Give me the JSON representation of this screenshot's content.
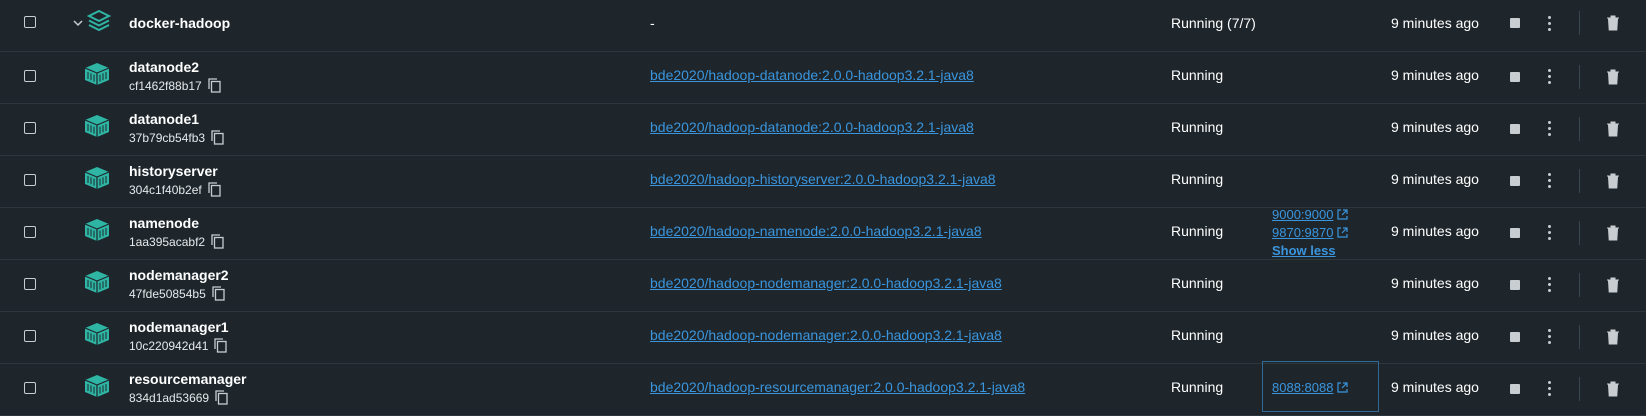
{
  "colors": {
    "background": "#1e262c",
    "accent": "#3a95dd",
    "icon_teal": "#2fb5a4"
  },
  "group": {
    "name": "docker-hadoop",
    "image": "-",
    "status": "Running (7/7)",
    "last_started": "9 minutes ago",
    "icon": "stack-icon"
  },
  "containers": [
    {
      "name": "datanode2",
      "id": "cf1462f88b17",
      "image": "bde2020/hadoop-datanode:2.0.0-hadoop3.2.1-java8",
      "status": "Running",
      "ports": [],
      "last_started": "9 minutes ago"
    },
    {
      "name": "datanode1",
      "id": "37b79cb54fb3",
      "image": "bde2020/hadoop-datanode:2.0.0-hadoop3.2.1-java8",
      "status": "Running",
      "ports": [],
      "last_started": "9 minutes ago"
    },
    {
      "name": "historyserver",
      "id": "304c1f40b2ef",
      "image": "bde2020/hadoop-historyserver:2.0.0-hadoop3.2.1-java8",
      "status": "Running",
      "ports": [],
      "last_started": "9 minutes ago"
    },
    {
      "name": "namenode",
      "id": "1aa395acabf2",
      "image": "bde2020/hadoop-namenode:2.0.0-hadoop3.2.1-java8",
      "status": "Running",
      "ports": [
        "9000:9000",
        "9870:9870"
      ],
      "ports_toggle": "Show less",
      "last_started": "9 minutes ago"
    },
    {
      "name": "nodemanager2",
      "id": "47fde50854b5",
      "image": "bde2020/hadoop-nodemanager:2.0.0-hadoop3.2.1-java8",
      "status": "Running",
      "ports": [],
      "last_started": "9 minutes ago"
    },
    {
      "name": "nodemanager1",
      "id": "10c220942d41",
      "image": "bde2020/hadoop-nodemanager:2.0.0-hadoop3.2.1-java8",
      "status": "Running",
      "ports": [],
      "last_started": "9 minutes ago"
    },
    {
      "name": "resourcemanager",
      "id": "834d1ad53669",
      "image": "bde2020/hadoop-resourcemanager:2.0.0-hadoop3.2.1-java8",
      "status": "Running",
      "ports": [
        "8088:8088"
      ],
      "last_started": "9 minutes ago"
    }
  ],
  "icons": {
    "checkbox": "checkbox-icon",
    "expand": "chevron-down-icon",
    "container": "container-icon",
    "copy": "copy-icon",
    "external": "external-link-icon",
    "stop": "stop-icon",
    "more": "kebab-menu-icon",
    "delete": "trash-icon"
  }
}
